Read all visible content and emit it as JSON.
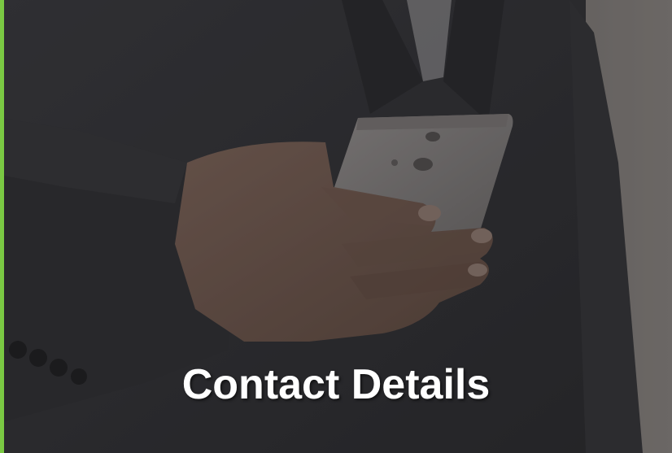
{
  "caption": {
    "text": "Contact Details"
  },
  "colors": {
    "accent": "#7ac943",
    "caption_text": "#ffffff",
    "suit": "#3a3a3d",
    "background_right": "#8f8a86"
  },
  "image": {
    "subject_icon": "hand-holding-phone-photo"
  }
}
